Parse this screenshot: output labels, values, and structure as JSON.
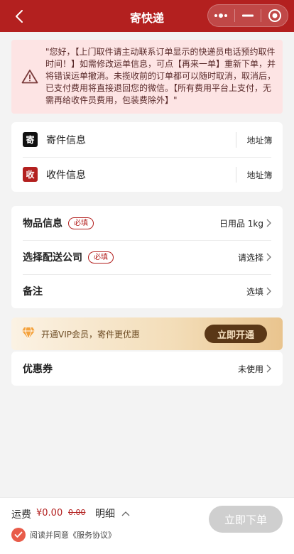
{
  "nav": {
    "title": "寄快递"
  },
  "notice": {
    "text": "\"您好，【上门取件请主动联系订单显示的快递员电话预约取件时间！】如需修改运单信息，可点【再来一单】重新下单，并将错误运单撤消。未揽收前的订单都可以随时取消，取消后，已支付费用将直接退回您的微信。【所有费用平台上支付，无需再给收件员费用，包装费除外】\""
  },
  "address": {
    "sender": {
      "badge": "寄",
      "label": "寄件信息",
      "book": "地址簿"
    },
    "receiver": {
      "badge": "收",
      "label": "收件信息",
      "book": "地址簿"
    }
  },
  "details": {
    "goods": {
      "label": "物品信息",
      "tag": "必填",
      "value": "日用品 1kg"
    },
    "courier": {
      "label": "选择配送公司",
      "tag": "必填",
      "value": "请选择"
    },
    "remark": {
      "label": "备注",
      "value": "选填"
    }
  },
  "vip": {
    "text": "开通VIP会员，寄件更优惠",
    "button": "立即开通"
  },
  "coupon": {
    "label": "优惠券",
    "value": "未使用"
  },
  "bottom": {
    "fee_label": "运费",
    "fee_value": "¥0.00",
    "fee_original": "0.00",
    "detail": "明细",
    "agree": "阅读并同意《服务协议》",
    "submit": "立即下单"
  },
  "colors": {
    "brand": "#b3201f",
    "notice_bg": "#fde4e4",
    "vip_button": "#5a3716"
  }
}
